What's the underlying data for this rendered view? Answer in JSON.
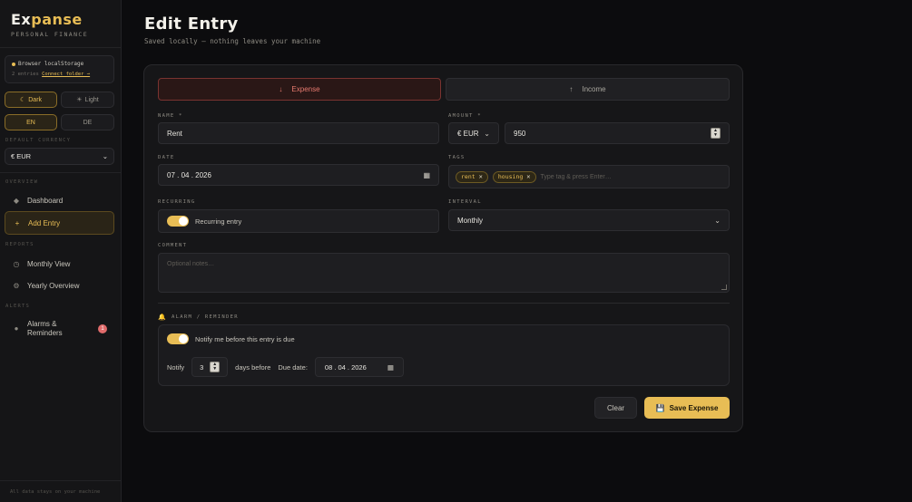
{
  "sidebar": {
    "brand": {
      "part1": "Ex",
      "part2": "panse",
      "subtitle": "PERSONAL FINANCE"
    },
    "storage": {
      "mode": "Browser localStorage",
      "entries": "2 entries",
      "link": "Connect folder →"
    },
    "theme": {
      "dark": "Dark",
      "light": "Light",
      "dark_icon": "☾",
      "light_icon": "☀"
    },
    "language": {
      "en": "EN",
      "de": "DE"
    },
    "currency": {
      "label": "DEFAULT CURRENCY",
      "value": "€ EUR"
    },
    "sections": {
      "overview": "OVERVIEW",
      "reports": "REPORTS",
      "alerts": "ALERTS"
    },
    "nav": {
      "dashboard": "Dashboard",
      "add_entry": "Add Entry",
      "monthly": "Monthly View",
      "yearly": "Yearly Overview",
      "alarms": "Alarms & Reminders",
      "alarms_badge": "1"
    },
    "footer": "All data stays on your machine"
  },
  "page": {
    "title": "Edit Entry",
    "subtitle": "Saved locally — nothing leaves your machine"
  },
  "form": {
    "type": {
      "expense": "Expense",
      "income": "Income",
      "expense_icon": "↓",
      "income_icon": "↑",
      "selected": "Expense"
    },
    "name": {
      "label": "NAME *",
      "value": "Rent"
    },
    "amount": {
      "label": "AMOUNT *",
      "currency": "€ EUR",
      "value": "950"
    },
    "date": {
      "label": "DATE",
      "value": "07 . 04 . 2026"
    },
    "tags": {
      "label": "TAGS",
      "items": [
        "rent",
        "housing"
      ],
      "placeholder": "Type tag & press Enter…"
    },
    "recurring": {
      "label": "RECURRING",
      "toggle_label": "Recurring entry",
      "on": true
    },
    "interval": {
      "label": "INTERVAL",
      "value": "Monthly"
    },
    "comment": {
      "label": "COMMENT",
      "placeholder": "Optional notes…"
    },
    "alarm": {
      "label": "ALARM / REMINDER",
      "toggle_label": "Notify me before this entry is due",
      "on": true,
      "notify": "Notify",
      "days": "3",
      "days_before": "days before",
      "due_label": "Due date:",
      "due_date": "08 . 04 . 2026"
    }
  },
  "actions": {
    "clear": "Clear",
    "save": "Save Expense"
  },
  "colors": {
    "accent": "#e8bd55",
    "expense": "#e77a6f",
    "background": "#0c0c0e",
    "badge": "#e06b6b"
  }
}
